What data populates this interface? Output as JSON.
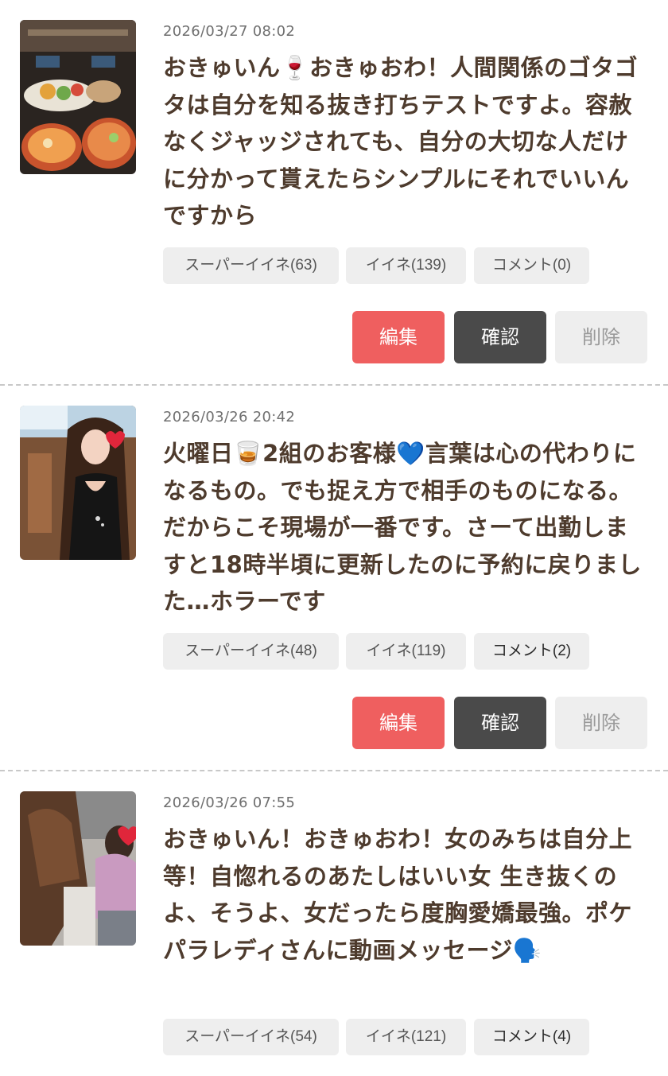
{
  "posts": [
    {
      "date": "2026/03/27 08:02",
      "text": "おきゅいん🍷おきゅおわ！人間関係のゴタゴタは自分を知る抜き打ちテストですよ。容赦なくジャッジされても、自分の大切な人だけに分かって貰えたらシンプルにそれでいいんですから",
      "super_like": "スーパーイイネ(63)",
      "like": "イイネ(139)",
      "comment": "コメント(0)",
      "edit_label": "編集",
      "confirm_label": "確認",
      "delete_label": "削除"
    },
    {
      "date": "2026/03/26 20:42",
      "text": "火曜日🥃2組のお客様💙言葉は心の代わりになるもの。でも捉え方で相手のものになる。だからこそ現場が一番です。さーて出勤しますと18時半頃に更新したのに予約に戻りました…ホラーです",
      "super_like": "スーパーイイネ(48)",
      "like": "イイネ(119)",
      "comment": "コメント(2)",
      "edit_label": "編集",
      "confirm_label": "確認",
      "delete_label": "削除"
    },
    {
      "date": "2026/03/26 07:55",
      "text": "おきゅいん！おきゅおわ！女のみちは自分上等！自惚れるのあたしはいい女 生き抜くのよ、そうよ、女だったら度胸愛嬌最強。ポケパラレディさんに動画メッセージ🗣️",
      "super_like": "スーパーイイネ(54)",
      "like": "イイネ(121)",
      "comment": "コメント(4)"
    }
  ],
  "colors": {
    "text_brown": "#4e3b2d",
    "edit_red": "#ef5f5f",
    "confirm_dark": "#4a4a4a",
    "chip_gray": "#eeeeee"
  }
}
